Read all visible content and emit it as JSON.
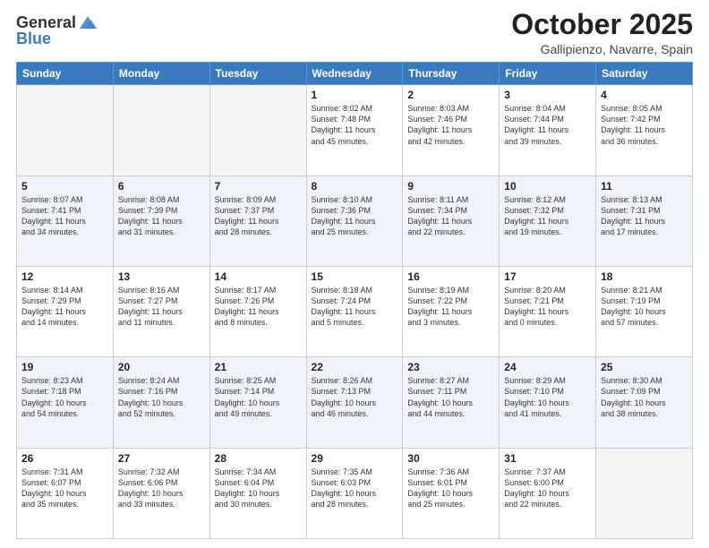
{
  "header": {
    "logo_general": "General",
    "logo_blue": "Blue",
    "month": "October 2025",
    "location": "Gallipienzo, Navarre, Spain"
  },
  "weekdays": [
    "Sunday",
    "Monday",
    "Tuesday",
    "Wednesday",
    "Thursday",
    "Friday",
    "Saturday"
  ],
  "weeks": [
    [
      {
        "day": "",
        "info": ""
      },
      {
        "day": "",
        "info": ""
      },
      {
        "day": "",
        "info": ""
      },
      {
        "day": "1",
        "info": "Sunrise: 8:02 AM\nSunset: 7:48 PM\nDaylight: 11 hours\nand 45 minutes."
      },
      {
        "day": "2",
        "info": "Sunrise: 8:03 AM\nSunset: 7:46 PM\nDaylight: 11 hours\nand 42 minutes."
      },
      {
        "day": "3",
        "info": "Sunrise: 8:04 AM\nSunset: 7:44 PM\nDaylight: 11 hours\nand 39 minutes."
      },
      {
        "day": "4",
        "info": "Sunrise: 8:05 AM\nSunset: 7:42 PM\nDaylight: 11 hours\nand 36 minutes."
      }
    ],
    [
      {
        "day": "5",
        "info": "Sunrise: 8:07 AM\nSunset: 7:41 PM\nDaylight: 11 hours\nand 34 minutes."
      },
      {
        "day": "6",
        "info": "Sunrise: 8:08 AM\nSunset: 7:39 PM\nDaylight: 11 hours\nand 31 minutes."
      },
      {
        "day": "7",
        "info": "Sunrise: 8:09 AM\nSunset: 7:37 PM\nDaylight: 11 hours\nand 28 minutes."
      },
      {
        "day": "8",
        "info": "Sunrise: 8:10 AM\nSunset: 7:36 PM\nDaylight: 11 hours\nand 25 minutes."
      },
      {
        "day": "9",
        "info": "Sunrise: 8:11 AM\nSunset: 7:34 PM\nDaylight: 11 hours\nand 22 minutes."
      },
      {
        "day": "10",
        "info": "Sunrise: 8:12 AM\nSunset: 7:32 PM\nDaylight: 11 hours\nand 19 minutes."
      },
      {
        "day": "11",
        "info": "Sunrise: 8:13 AM\nSunset: 7:31 PM\nDaylight: 11 hours\nand 17 minutes."
      }
    ],
    [
      {
        "day": "12",
        "info": "Sunrise: 8:14 AM\nSunset: 7:29 PM\nDaylight: 11 hours\nand 14 minutes."
      },
      {
        "day": "13",
        "info": "Sunrise: 8:16 AM\nSunset: 7:27 PM\nDaylight: 11 hours\nand 11 minutes."
      },
      {
        "day": "14",
        "info": "Sunrise: 8:17 AM\nSunset: 7:26 PM\nDaylight: 11 hours\nand 8 minutes."
      },
      {
        "day": "15",
        "info": "Sunrise: 8:18 AM\nSunset: 7:24 PM\nDaylight: 11 hours\nand 5 minutes."
      },
      {
        "day": "16",
        "info": "Sunrise: 8:19 AM\nSunset: 7:22 PM\nDaylight: 11 hours\nand 3 minutes."
      },
      {
        "day": "17",
        "info": "Sunrise: 8:20 AM\nSunset: 7:21 PM\nDaylight: 11 hours\nand 0 minutes."
      },
      {
        "day": "18",
        "info": "Sunrise: 8:21 AM\nSunset: 7:19 PM\nDaylight: 10 hours\nand 57 minutes."
      }
    ],
    [
      {
        "day": "19",
        "info": "Sunrise: 8:23 AM\nSunset: 7:18 PM\nDaylight: 10 hours\nand 54 minutes."
      },
      {
        "day": "20",
        "info": "Sunrise: 8:24 AM\nSunset: 7:16 PM\nDaylight: 10 hours\nand 52 minutes."
      },
      {
        "day": "21",
        "info": "Sunrise: 8:25 AM\nSunset: 7:14 PM\nDaylight: 10 hours\nand 49 minutes."
      },
      {
        "day": "22",
        "info": "Sunrise: 8:26 AM\nSunset: 7:13 PM\nDaylight: 10 hours\nand 46 minutes."
      },
      {
        "day": "23",
        "info": "Sunrise: 8:27 AM\nSunset: 7:11 PM\nDaylight: 10 hours\nand 44 minutes."
      },
      {
        "day": "24",
        "info": "Sunrise: 8:29 AM\nSunset: 7:10 PM\nDaylight: 10 hours\nand 41 minutes."
      },
      {
        "day": "25",
        "info": "Sunrise: 8:30 AM\nSunset: 7:09 PM\nDaylight: 10 hours\nand 38 minutes."
      }
    ],
    [
      {
        "day": "26",
        "info": "Sunrise: 7:31 AM\nSunset: 6:07 PM\nDaylight: 10 hours\nand 35 minutes."
      },
      {
        "day": "27",
        "info": "Sunrise: 7:32 AM\nSunset: 6:06 PM\nDaylight: 10 hours\nand 33 minutes."
      },
      {
        "day": "28",
        "info": "Sunrise: 7:34 AM\nSunset: 6:04 PM\nDaylight: 10 hours\nand 30 minutes."
      },
      {
        "day": "29",
        "info": "Sunrise: 7:35 AM\nSunset: 6:03 PM\nDaylight: 10 hours\nand 28 minutes."
      },
      {
        "day": "30",
        "info": "Sunrise: 7:36 AM\nSunset: 6:01 PM\nDaylight: 10 hours\nand 25 minutes."
      },
      {
        "day": "31",
        "info": "Sunrise: 7:37 AM\nSunset: 6:00 PM\nDaylight: 10 hours\nand 22 minutes."
      },
      {
        "day": "",
        "info": ""
      }
    ]
  ]
}
